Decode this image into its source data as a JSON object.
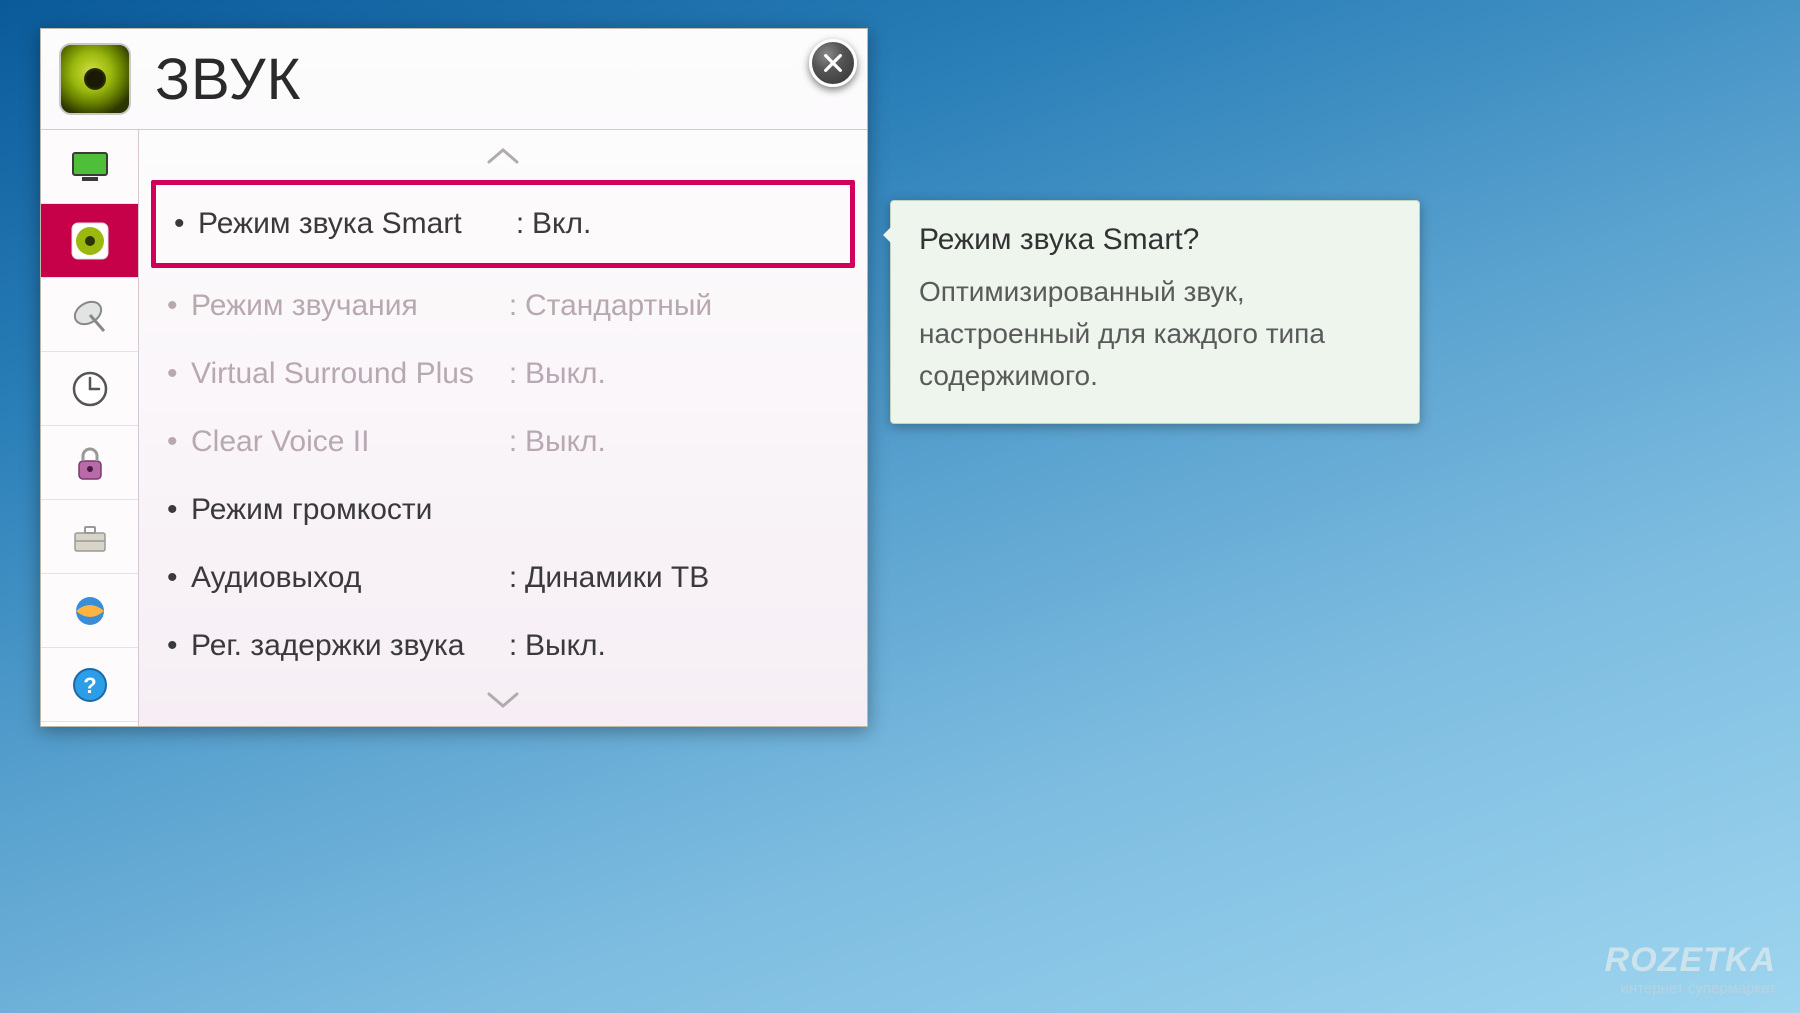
{
  "header": {
    "title": "ЗВУК",
    "icon": "speaker-icon"
  },
  "sidebar": {
    "items": [
      {
        "icon": "tv-icon",
        "active": false
      },
      {
        "icon": "speaker-icon",
        "active": true
      },
      {
        "icon": "satellite-icon",
        "active": false
      },
      {
        "icon": "clock-icon",
        "active": false
      },
      {
        "icon": "lock-icon",
        "active": false
      },
      {
        "icon": "toolbox-icon",
        "active": false
      },
      {
        "icon": "network-icon",
        "active": false
      },
      {
        "icon": "help-icon",
        "active": false
      }
    ]
  },
  "menu": {
    "items": [
      {
        "label": "Режим звука Smart",
        "value": "Вкл.",
        "selected": true,
        "disabled": false
      },
      {
        "label": "Режим звучания",
        "value": "Стандартный",
        "selected": false,
        "disabled": true
      },
      {
        "label": "Virtual Surround Plus",
        "value": "Выкл.",
        "selected": false,
        "disabled": true
      },
      {
        "label": "Clear Voice II",
        "value": "Выкл.",
        "selected": false,
        "disabled": true
      },
      {
        "label": "Режим громкости",
        "value": "",
        "selected": false,
        "disabled": false
      },
      {
        "label": "Аудиовыход",
        "value": "Динамики ТВ",
        "selected": false,
        "disabled": false
      },
      {
        "label": "Рег. задержки звука",
        "value": "Выкл.",
        "selected": false,
        "disabled": false
      }
    ]
  },
  "tooltip": {
    "title": "Режим звука Smart?",
    "body": "Оптимизированный звук, настроенный для каждого типа содержимого."
  },
  "watermark": {
    "brand": "ROZETKA",
    "sub": "интернет супермаркет"
  },
  "colors": {
    "accent": "#d10059"
  }
}
